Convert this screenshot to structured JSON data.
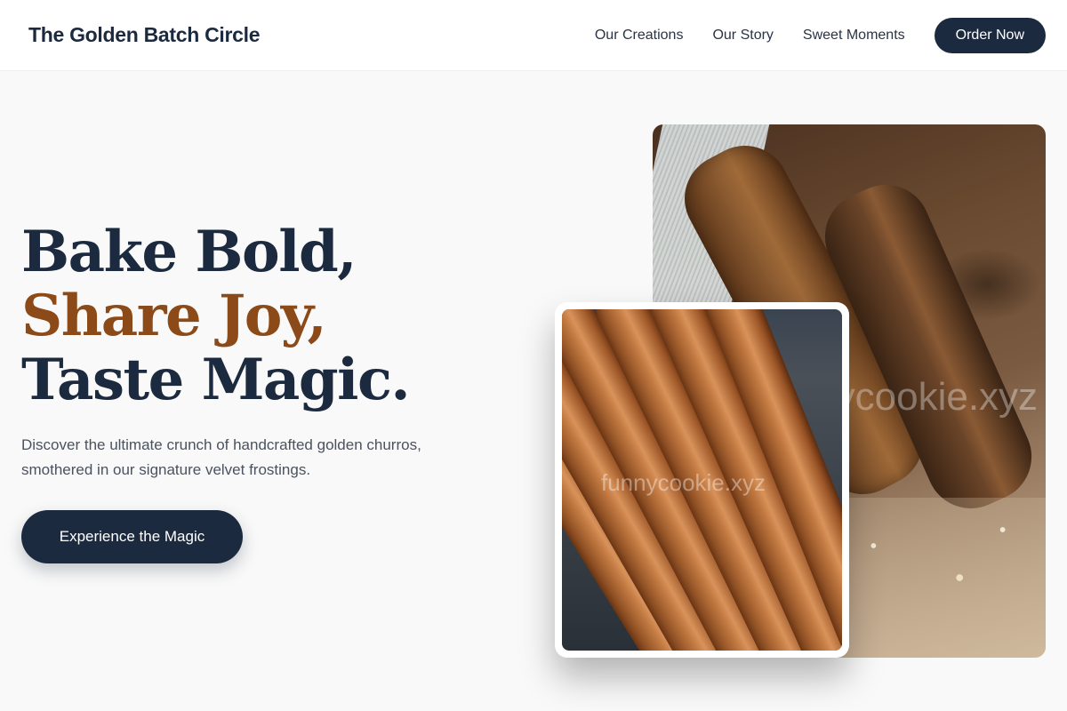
{
  "brand": {
    "name": "The Golden Batch Circle"
  },
  "nav": {
    "links": [
      "Our Creations",
      "Our Story",
      "Sweet Moments"
    ],
    "order_label": "Order Now"
  },
  "hero": {
    "headline_1": "Bake Bold,",
    "headline_2": "Share Joy,",
    "headline_3": "Taste Magic.",
    "subtext": "Discover the ultimate crunch of handcrafted golden churros, smothered in our signature velvet frostings.",
    "cta_label": "Experience the Magic"
  },
  "images": {
    "back_watermark": "funnycookie.xyz",
    "front_watermark": "funnycookie.xyz"
  },
  "colors": {
    "navy": "#1c2a3f",
    "accent_brown": "#8b4a17",
    "background": "#f9f9f9"
  }
}
